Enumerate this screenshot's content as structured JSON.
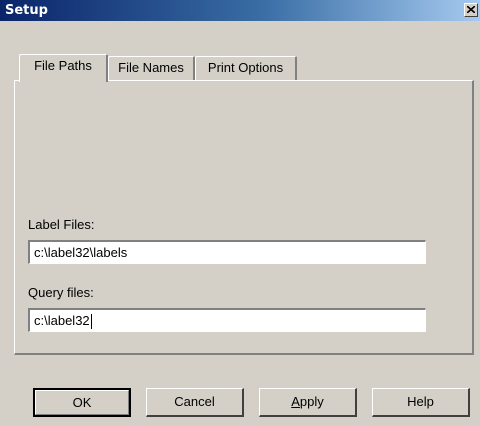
{
  "window": {
    "title": "Setup",
    "close_glyph": "X"
  },
  "tabs": [
    {
      "label": "File Paths",
      "active": true
    },
    {
      "label": "File Names",
      "active": false
    },
    {
      "label": "Print Options",
      "active": false
    }
  ],
  "file_paths": {
    "label_files_label": "Label Files:",
    "label_files_value": "c:\\label32\\labels",
    "query_files_label": "Query files:",
    "query_files_value": "c:\\label32"
  },
  "buttons": {
    "ok": "OK",
    "cancel": "Cancel",
    "apply_mnemonic": "A",
    "apply_rest": "pply",
    "help": "Help"
  },
  "icons": {
    "close": "close-icon"
  },
  "colors": {
    "face": "#d4d0c8",
    "title_start": "#0a246a",
    "title_end": "#a6caf0"
  }
}
